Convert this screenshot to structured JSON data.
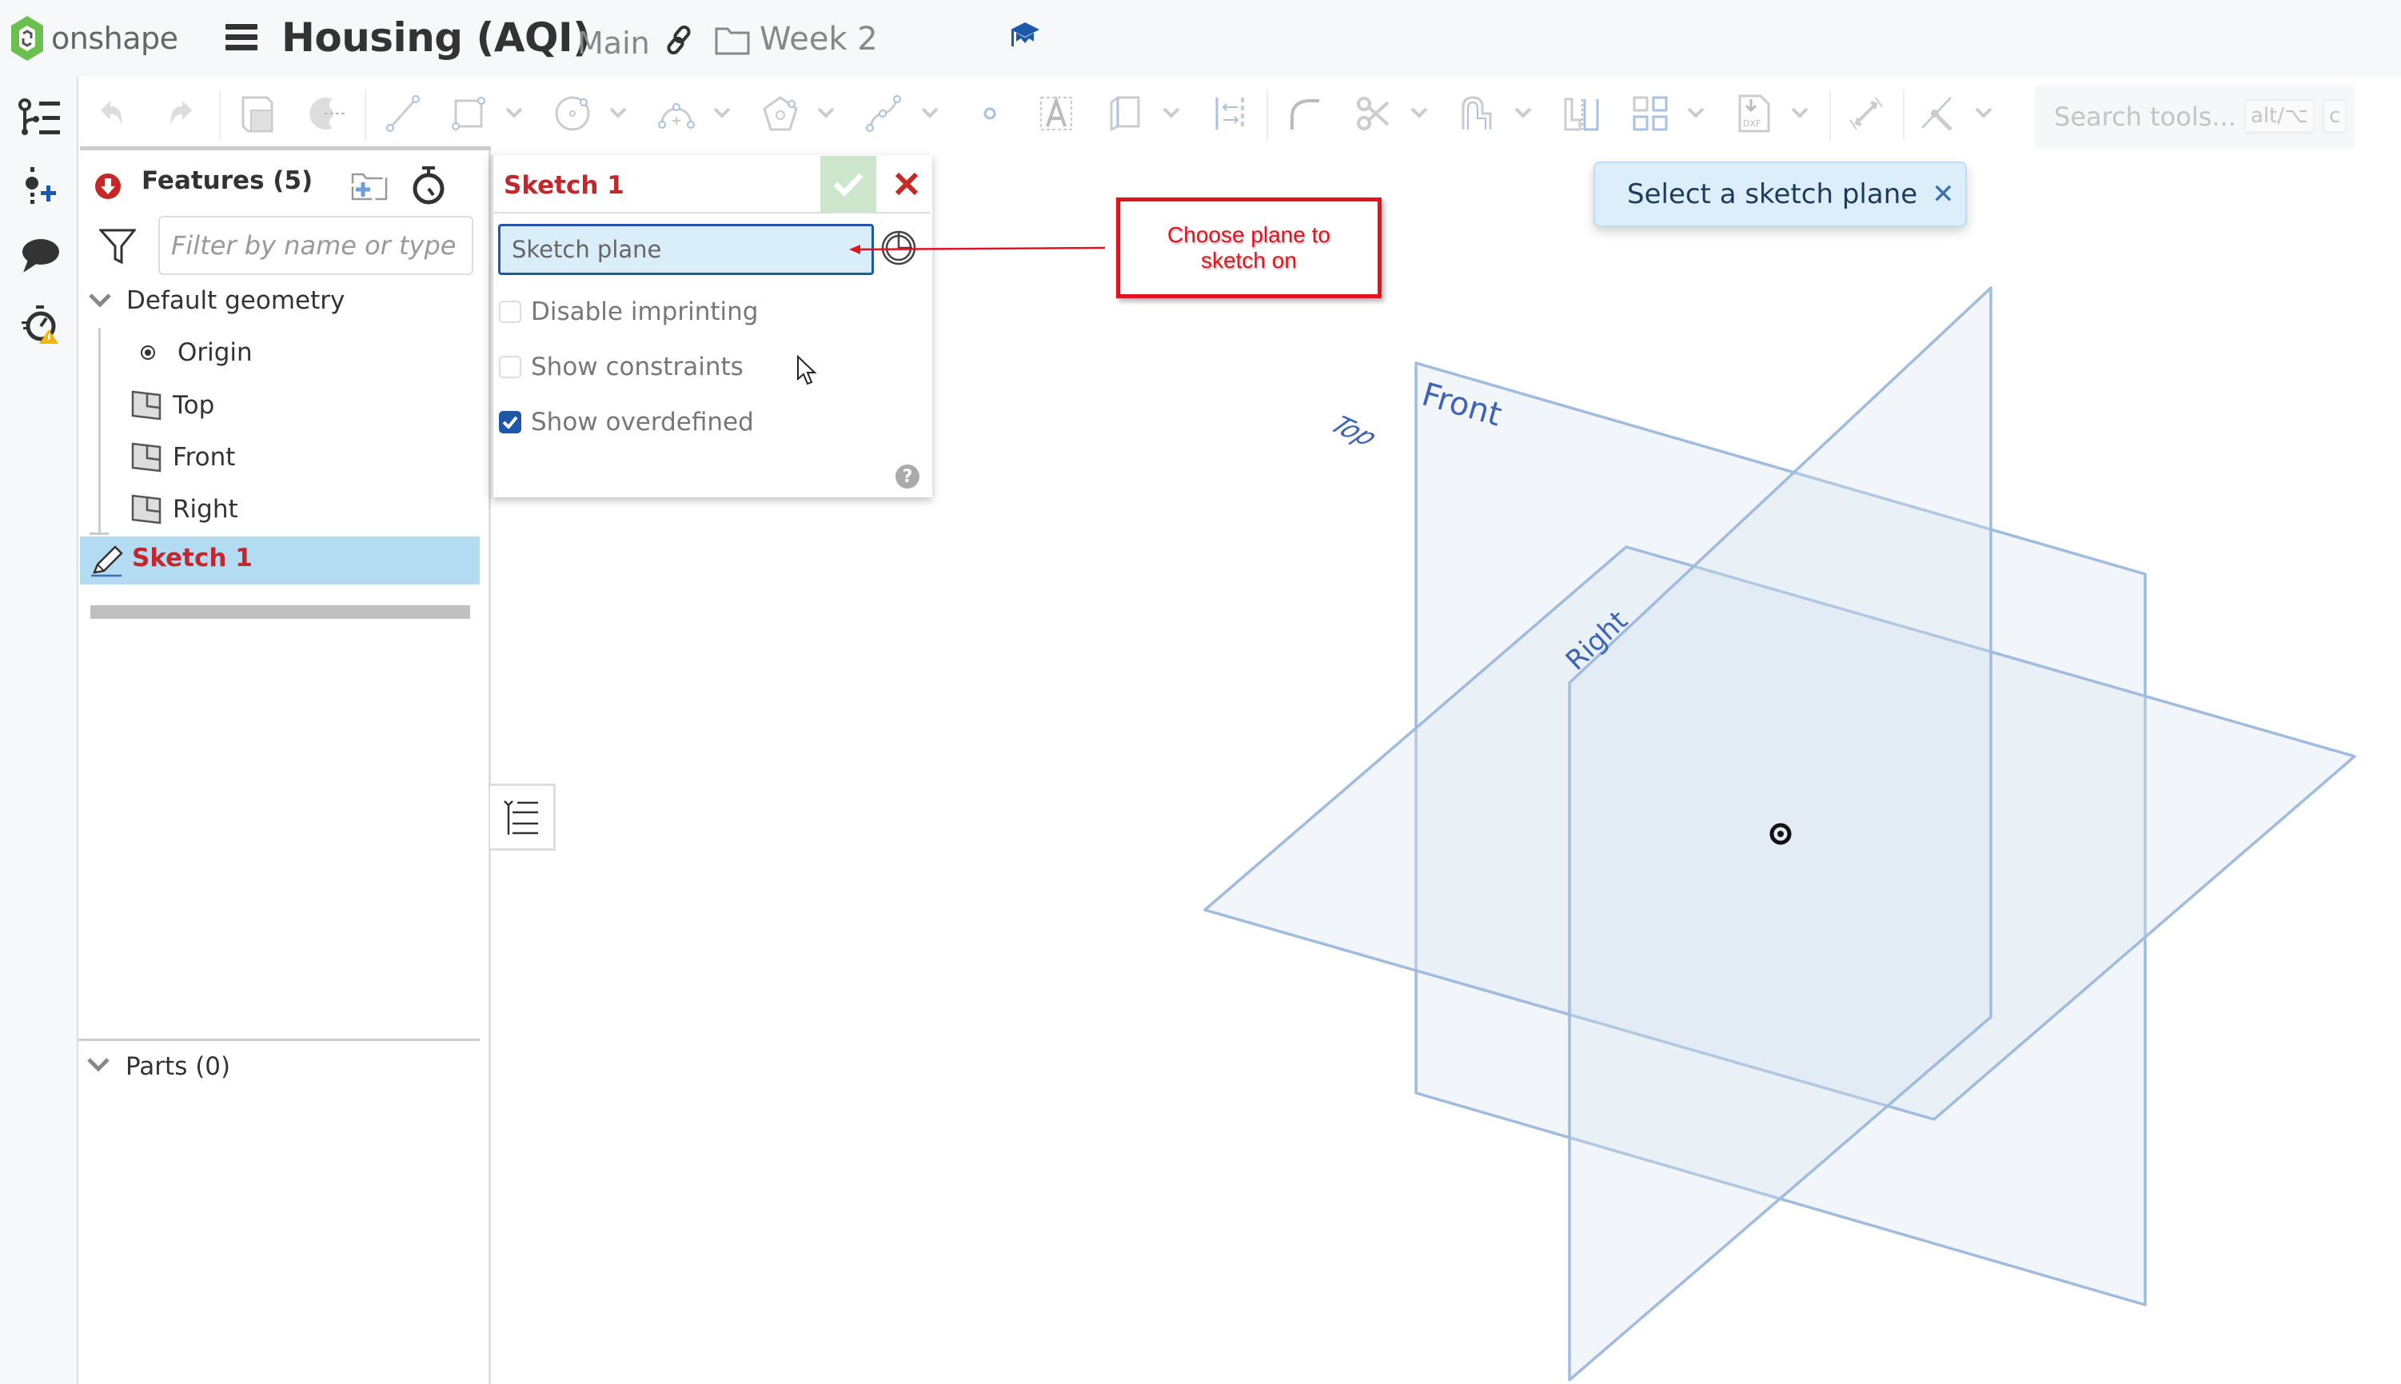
{
  "app": {
    "logo_text": "onshape",
    "document_title": "Housing (AQI)",
    "branch": "Main",
    "folder": "Week 2",
    "brand_color": "#6bbf4e",
    "accent_color": "#1d59a8"
  },
  "left_rail": {
    "items": [
      {
        "icon": "feature-list-icon"
      },
      {
        "icon": "insert-icon"
      },
      {
        "icon": "comments-icon"
      },
      {
        "icon": "performance-warning-icon"
      }
    ]
  },
  "toolbar": {
    "tools": [
      "undo",
      "redo",
      "new-sketch",
      "extrude-revolve",
      "line",
      "rectangle",
      "circle",
      "arc",
      "polygon",
      "spline",
      "point",
      "text",
      "construction",
      "mirror-offset",
      "fillet",
      "trim",
      "offset",
      "split",
      "pattern",
      "dxf-insert",
      "dimension",
      "midpoint"
    ],
    "search_placeholder": "Search tools...",
    "shortcut_key1": "alt/⌥",
    "shortcut_key2": "c"
  },
  "feature_panel": {
    "title": "Features (5)",
    "filter_placeholder": "Filter by name or type",
    "default_geometry_label": "Default geometry",
    "default_geometry_items": [
      {
        "label": "Origin",
        "icon": "origin-icon"
      },
      {
        "label": "Top",
        "icon": "plane-icon"
      },
      {
        "label": "Front",
        "icon": "plane-icon"
      },
      {
        "label": "Right",
        "icon": "plane-icon"
      }
    ],
    "active_feature": "Sketch 1",
    "parts_label": "Parts (0)"
  },
  "sketch_dialog": {
    "title": "Sketch 1",
    "sketch_plane_placeholder": "Sketch plane",
    "options": [
      {
        "label": "Disable imprinting",
        "checked": false
      },
      {
        "label": "Show constraints",
        "checked": false
      },
      {
        "label": "Show overdefined",
        "checked": true
      }
    ],
    "help": "?"
  },
  "annotation": {
    "text": "Choose plane to sketch on",
    "color": "#e0141e"
  },
  "toast": {
    "message": "Select a sketch plane",
    "close": "✕"
  },
  "viewport": {
    "planes": [
      {
        "name": "Front",
        "label": "Front"
      },
      {
        "name": "Top",
        "label": "Top"
      },
      {
        "name": "Right",
        "label": "Right"
      }
    ],
    "plane_color": "#7fa3cf"
  }
}
